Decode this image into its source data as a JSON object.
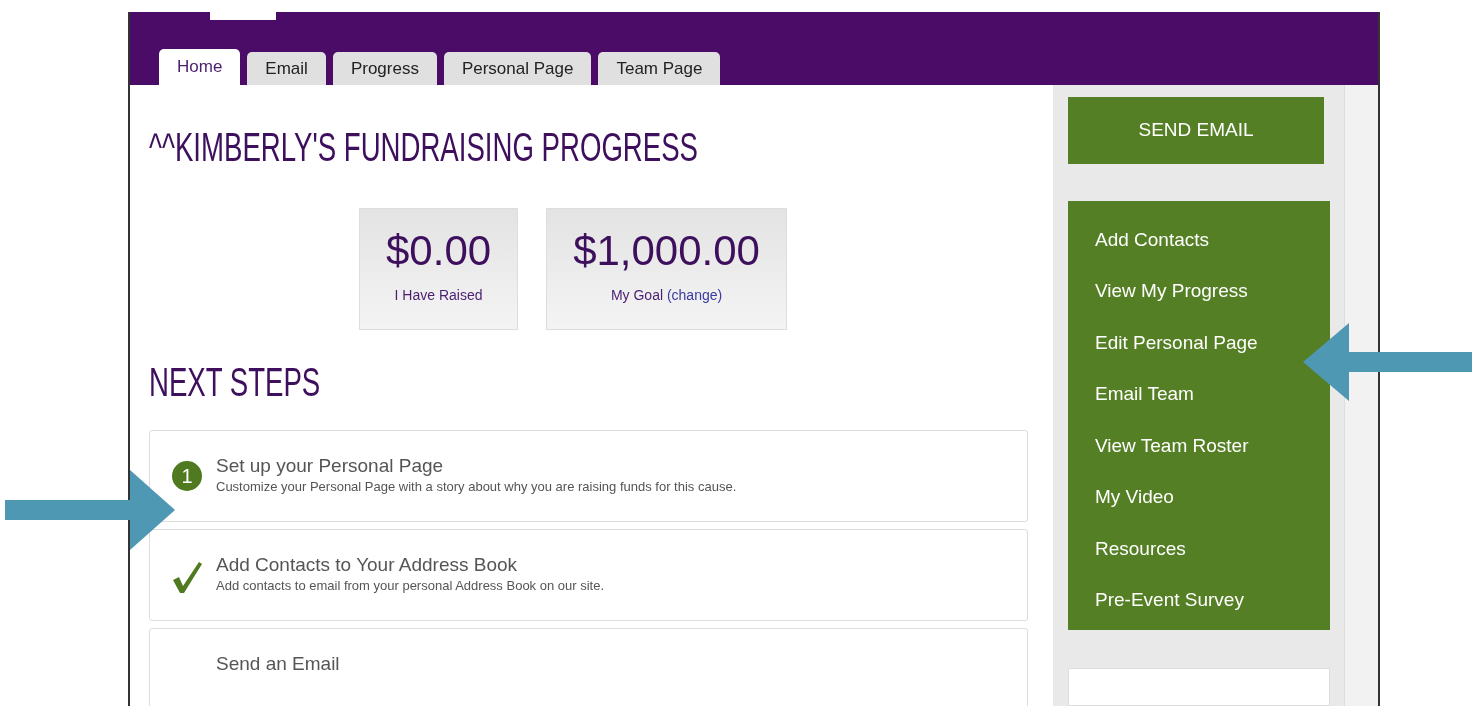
{
  "tabs": [
    {
      "label": "Home",
      "selected": true
    },
    {
      "label": "Email",
      "selected": false
    },
    {
      "label": "Progress",
      "selected": false
    },
    {
      "label": "Personal Page",
      "selected": false
    },
    {
      "label": "Team Page",
      "selected": false
    }
  ],
  "title": "^^KIMBERLY'S FUNDRAISING PROGRESS",
  "stats": [
    {
      "amount": "$0.00",
      "label": "I Have Raised"
    },
    {
      "amount": "$1,000.00",
      "label": "My Goal",
      "link": "(change)"
    }
  ],
  "next_steps": {
    "heading": "NEXT STEPS",
    "steps": [
      {
        "kind": "number",
        "number": "1",
        "title": "Set up your Personal Page",
        "description": "Customize your Personal Page with a story about why you are raising funds for this cause."
      },
      {
        "kind": "done",
        "title": "Add Contacts to Your Address Book",
        "description": "Add contacts to email from your personal Address Book on our site."
      },
      {
        "kind": "pending",
        "title": "Send an Email"
      }
    ]
  },
  "sidebar": {
    "button": "SEND EMAIL",
    "links": [
      "Add Contacts",
      "View My Progress",
      "Edit Personal Page",
      "Email Team",
      "View Team Roster",
      "My Video",
      "Resources",
      "Pre-Event Survey"
    ]
  }
}
